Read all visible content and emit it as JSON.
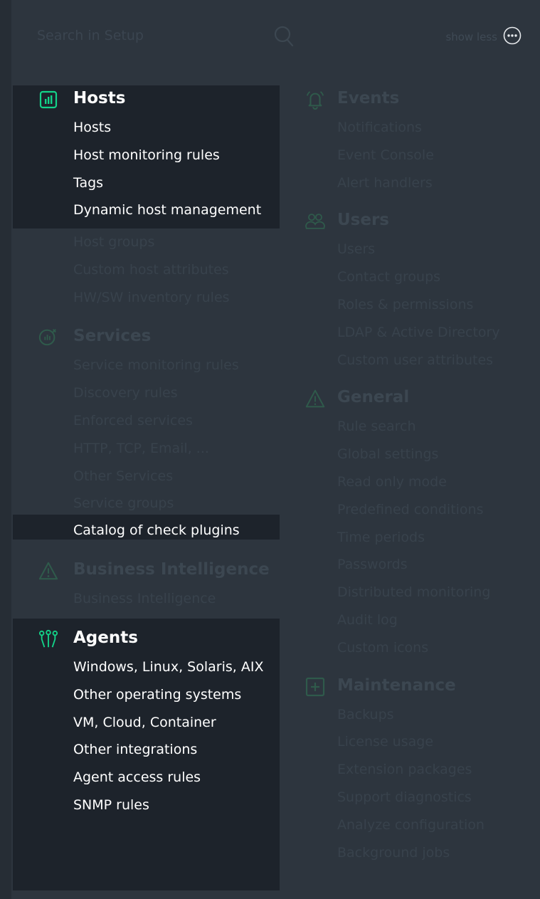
{
  "search": {
    "placeholder": "Search in Setup"
  },
  "header": {
    "show_less_label": "show less"
  },
  "colors": {
    "accent": "#13d389",
    "dim_icon": "#2f5a4b",
    "dim_text": "#38424c"
  },
  "left_column": {
    "hosts": {
      "title": "Hosts",
      "icon": "host-icon",
      "highlighted_items": [
        "Hosts",
        "Host monitoring rules",
        "Tags",
        "Dynamic host management"
      ],
      "other_items": [
        "Host groups",
        "Custom host attributes",
        "HW/SW inventory rules"
      ]
    },
    "services": {
      "title": "Services",
      "icon": "service-icon",
      "other_items": [
        "Service monitoring rules",
        "Discovery rules",
        "Enforced services",
        "HTTP, TCP, Email, ...",
        "Other Services",
        "Service groups"
      ],
      "highlighted_items": [
        "Catalog of check plugins"
      ]
    },
    "bi": {
      "title": "Business Intelligence",
      "icon": "warning-triangle-icon",
      "items": [
        "Business Intelligence"
      ]
    },
    "agents": {
      "title": "Agents",
      "icon": "agents-icon",
      "items": [
        "Windows, Linux, Solaris, AIX",
        "Other operating systems",
        "VM, Cloud, Container",
        "Other integrations",
        "Agent access rules",
        "SNMP rules"
      ]
    }
  },
  "right_column": {
    "events": {
      "title": "Events",
      "icon": "bell-icon",
      "items": [
        "Notifications",
        "Event Console",
        "Alert handlers"
      ]
    },
    "users": {
      "title": "Users",
      "icon": "users-icon",
      "items": [
        "Users",
        "Contact groups",
        "Roles & permissions",
        "LDAP & Active Directory",
        "Custom user attributes"
      ]
    },
    "general": {
      "title": "General",
      "icon": "warning-triangle-icon",
      "items": [
        "Rule search",
        "Global settings",
        "Read only mode",
        "Predefined conditions",
        "Time periods",
        "Passwords",
        "Distributed monitoring",
        "Audit log",
        "Custom icons"
      ]
    },
    "maintenance": {
      "title": "Maintenance",
      "icon": "plus-box-icon",
      "items": [
        "Backups",
        "License usage",
        "Extension packages",
        "Support diagnostics",
        "Analyze configuration",
        "Background jobs"
      ]
    }
  }
}
